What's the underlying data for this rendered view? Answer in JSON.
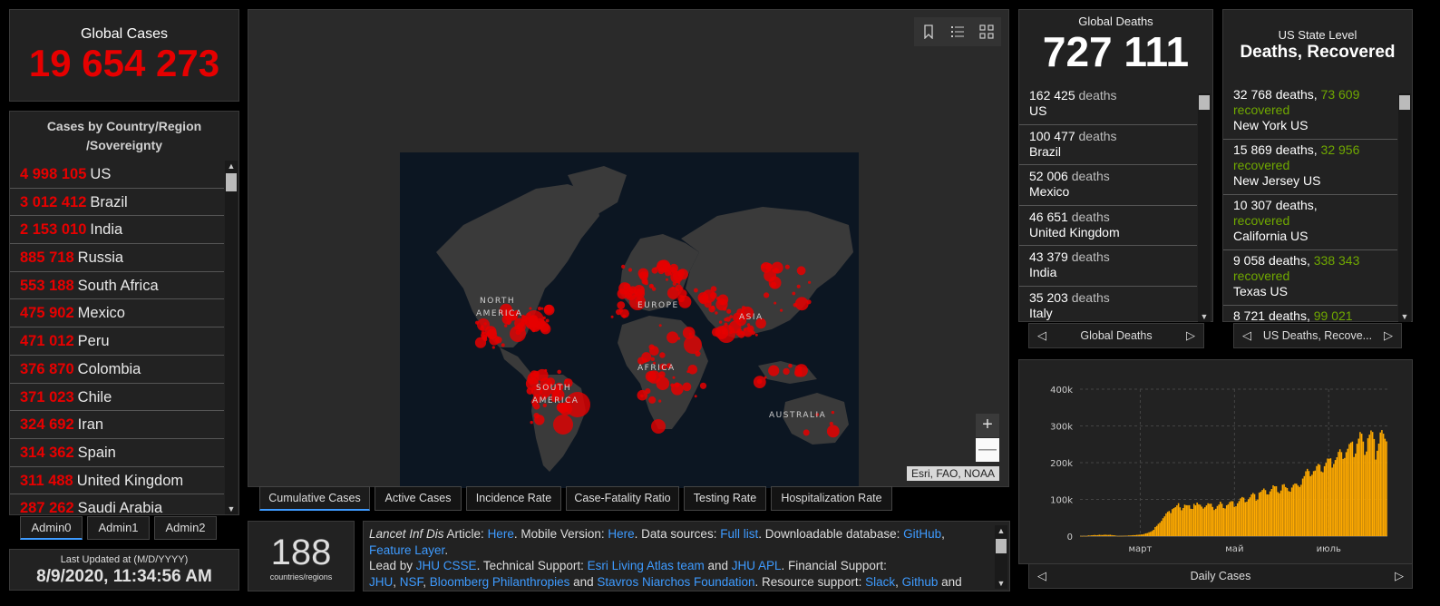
{
  "global_cases": {
    "title": "Global Cases",
    "value": "19 654 273"
  },
  "country_panel": {
    "title_line1": "Cases by Country/Region",
    "title_line2": "/Sovereignty",
    "items": [
      {
        "num": "4 998 105",
        "name": "US"
      },
      {
        "num": "3 012 412",
        "name": "Brazil"
      },
      {
        "num": "2 153 010",
        "name": "India"
      },
      {
        "num": "885 718",
        "name": "Russia"
      },
      {
        "num": "553 188",
        "name": "South Africa"
      },
      {
        "num": "475 902",
        "name": "Mexico"
      },
      {
        "num": "471 012",
        "name": "Peru"
      },
      {
        "num": "376 870",
        "name": "Colombia"
      },
      {
        "num": "371 023",
        "name": "Chile"
      },
      {
        "num": "324 692",
        "name": "Iran"
      },
      {
        "num": "314 362",
        "name": "Spain"
      },
      {
        "num": "311 488",
        "name": "United Kingdom"
      },
      {
        "num": "287 262",
        "name": "Saudi Arabia"
      }
    ]
  },
  "admin_tabs": [
    "Admin0",
    "Admin1",
    "Admin2"
  ],
  "last_updated": {
    "title": "Last Updated at (M/D/YYYY)",
    "value": "8/9/2020, 11:34:56 AM"
  },
  "map": {
    "labels": [
      "NORTH",
      "AMERICA",
      "EUROPE",
      "ASIA",
      "AFRICA",
      "SOUTH",
      "AMERICA",
      "AUSTRALIA"
    ],
    "attribution": "Esri, FAO, NOAA",
    "zoom_in": "+",
    "zoom_out": "—",
    "dot_color": "#e60000"
  },
  "map_tabs": [
    "Cumulative Cases",
    "Active Cases",
    "Incidence Rate",
    "Case-Fatality Ratio",
    "Testing Rate",
    "Hospitalization Rate"
  ],
  "count_panel": {
    "value": "188",
    "label": "countries/regions"
  },
  "info": {
    "t1": "Lancet Inf Dis",
    "t2": " Article: ",
    "l_here1": "Here",
    "t3": ". Mobile Version: ",
    "l_here2": "Here",
    "t4": ". Data sources: ",
    "l_full": "Full list",
    "t5": ". Downloadable database: ",
    "l_github": "GitHub",
    "t6": ", ",
    "l_feature": "Feature Layer",
    "t7": ".",
    "t8": "Lead by ",
    "l_jhu_csse": "JHU CSSE",
    "t9": ". Technical Support: ",
    "l_esri": "Esri Living Atlas team",
    "t10": " and ",
    "l_apl": "JHU APL",
    "t11": ". Financial Support:",
    "l_jhu": "JHU",
    "t12": ", ",
    "l_nsf": "NSF",
    "t13": ", ",
    "l_bloomberg": "Bloomberg Philanthropies",
    "t14": " and ",
    "l_stavros": "Stavros Niarchos Foundation",
    "t15": ". Resource support: ",
    "l_slack": "Slack",
    "t16": ", ",
    "l_github2": "Github",
    "t17": " and"
  },
  "deaths_panel": {
    "title": "Global Deaths",
    "value": "727 111",
    "unit": "deaths",
    "items": [
      {
        "num": "162 425",
        "name": "US"
      },
      {
        "num": "100 477",
        "name": "Brazil"
      },
      {
        "num": "52 006",
        "name": "Mexico"
      },
      {
        "num": "46 651",
        "name": "United Kingdom"
      },
      {
        "num": "43 379",
        "name": "India"
      },
      {
        "num": "35 203",
        "name": "Italy"
      }
    ],
    "pager_label": "Global Deaths"
  },
  "us_panel": {
    "title": "US State Level",
    "subtitle": "Deaths, Recovered",
    "deaths_word": "deaths,",
    "recovered_word": "recovered",
    "items": [
      {
        "deaths": "32 768",
        "recovered": "73 609",
        "name": "New York US"
      },
      {
        "deaths": "15 869",
        "recovered": "32 956",
        "name": "New Jersey US"
      },
      {
        "deaths": "10 307",
        "recovered": "",
        "name": "California US"
      },
      {
        "deaths": "9 058",
        "recovered": "338 343",
        "name": "Texas US"
      },
      {
        "deaths": "8 721",
        "recovered": "99 021",
        "name": ""
      }
    ],
    "pager_label": "US Deaths, Recove..."
  },
  "chart_data": {
    "type": "bar",
    "title": "",
    "xlabel": "",
    "ylabel": "",
    "ylim": [
      0,
      400000
    ],
    "yticks": [
      "0",
      "100k",
      "200k",
      "300k",
      "400k"
    ],
    "xticks": [
      "март",
      "май",
      "июль"
    ],
    "x_start": "2020-01-22",
    "x_end": "2020-08-08",
    "tick_dates": [
      "2020-03-01",
      "2020-05-01",
      "2020-07-01"
    ],
    "bar_color": "#ffaa00",
    "values": [
      600,
      200,
      800,
      300,
      400,
      2000,
      1700,
      2200,
      2600,
      3100,
      2600,
      2800,
      3700,
      3200,
      2900,
      3600,
      3800,
      3400,
      3300,
      3800,
      2900,
      2300,
      2000,
      1000,
      400,
      600,
      600,
      700,
      900,
      1000,
      1200,
      1900,
      1800,
      2200,
      2800,
      2600,
      3400,
      3700,
      4000,
      4500,
      4700,
      6200,
      7600,
      8400,
      10600,
      11700,
      14100,
      17200,
      24800,
      28000,
      33400,
      36600,
      41500,
      48800,
      53900,
      61500,
      66100,
      68600,
      62800,
      73600,
      76400,
      78900,
      83800,
      89700,
      78400,
      70500,
      76500,
      85700,
      84200,
      84100,
      84200,
      74500,
      74000,
      87800,
      83900,
      91400,
      86600,
      85500,
      80300,
      75000,
      78700,
      83800,
      89500,
      88100,
      88400,
      79400,
      71100,
      74500,
      82000,
      86000,
      93800,
      88100,
      76500,
      75300,
      84000,
      86800,
      92900,
      95200,
      95000,
      79800,
      81300,
      89400,
      95400,
      102800,
      106500,
      104700,
      92500,
      93800,
      100500,
      105600,
      113400,
      117600,
      114400,
      97000,
      100000,
      118300,
      120800,
      125600,
      129700,
      125400,
      113800,
      113500,
      121800,
      128400,
      138200,
      135700,
      135900,
      120000,
      116800,
      124100,
      140100,
      141500,
      133600,
      130900,
      122600,
      121000,
      132300,
      139900,
      143300,
      142800,
      137800,
      133800,
      139900,
      156700,
      163400,
      176600,
      183100,
      177200,
      163100,
      167100,
      177000,
      178500,
      190800,
      196700,
      194400,
      176100,
      174000,
      190300,
      199400,
      211200,
      210700,
      211900,
      186600,
      196500,
      207200,
      214700,
      229300,
      236400,
      228800,
      210200,
      212800,
      228600,
      237800,
      250600,
      254800,
      257400,
      215300,
      224900,
      251500,
      265400,
      283300,
      278900,
      257500,
      221100,
      230300,
      266400,
      276100,
      287700,
      283600,
      264400,
      208500,
      232400,
      251900,
      282200,
      288800,
      278900,
      265100,
      258000
    ]
  },
  "chart_pager": {
    "label": "Daily Cases"
  }
}
